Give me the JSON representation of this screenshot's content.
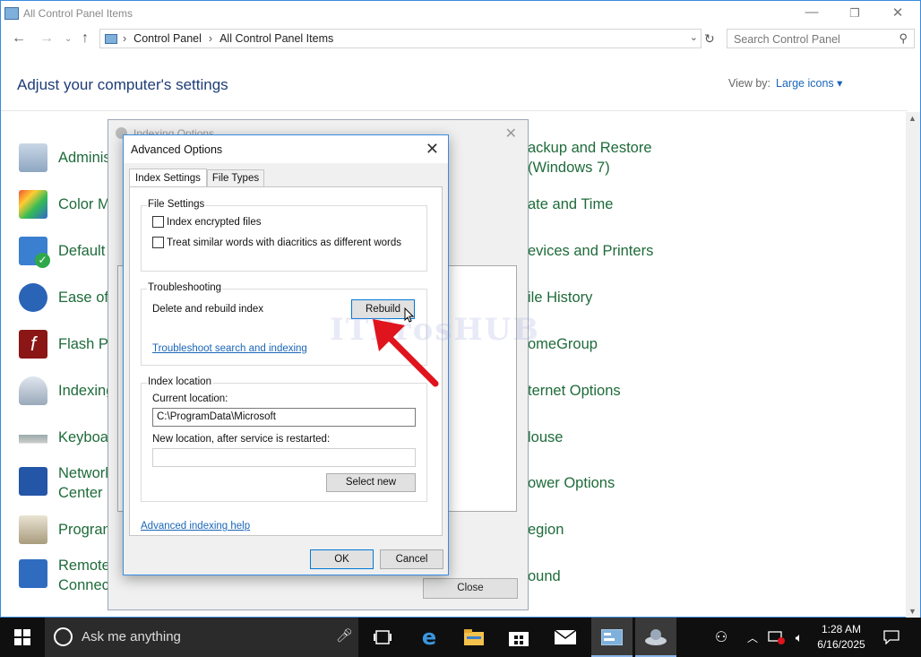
{
  "window": {
    "title": "All Control Panel Items",
    "minimize": "—",
    "restore": "❐",
    "close": "✕"
  },
  "addressbar": {
    "crumbs": [
      "Control Panel",
      "All Control Panel Items"
    ],
    "search_placeholder": "Search Control Panel"
  },
  "main": {
    "heading": "Adjust your computer's settings",
    "viewby_label": "View by:",
    "viewby_value": "Large icons ▾",
    "left_items": [
      "Adminis",
      "Color M",
      "Default",
      "Ease of A",
      "Flash Pla",
      "Indexing",
      "Keyboar",
      "Networl\nCenter",
      "Program",
      "Remote\nConnect"
    ],
    "right_items": [
      "ackup and Restore\n(Windows 7)",
      "ate and Time",
      "evices and Printers",
      "ile History",
      "omeGroup",
      "ternet Options",
      "louse",
      "ower Options",
      "egion",
      "ound"
    ]
  },
  "indexing_dialog": {
    "title": "Indexing Options",
    "close_label": "Close"
  },
  "advanced": {
    "title": "Advanced Options",
    "tabs": [
      "Index Settings",
      "File Types"
    ],
    "file_settings": {
      "label": "File Settings",
      "opt1": "Index encrypted files",
      "opt2": "Treat similar words with diacritics as different words"
    },
    "troubleshooting": {
      "label": "Troubleshooting",
      "text": "Delete and rebuild index",
      "rebuild": "Rebuild",
      "link": "Troubleshoot search and indexing"
    },
    "index_location": {
      "label": "Index location",
      "current_label": "Current location:",
      "current_value": "C:\\ProgramData\\Microsoft",
      "new_label": "New location, after service is restarted:",
      "new_value": "",
      "select_new": "Select new"
    },
    "help_link": "Advanced indexing help",
    "ok": "OK",
    "cancel": "Cancel"
  },
  "watermark": "ITProsHUB",
  "taskbar": {
    "search_placeholder": "Ask me anything",
    "time": "1:28 AM",
    "date": "6/16/2025"
  },
  "colors": {
    "accent": "#3a8be0",
    "link": "#1a66b8",
    "item_green": "#1e6b3a",
    "arrow_red": "#e0141c"
  }
}
